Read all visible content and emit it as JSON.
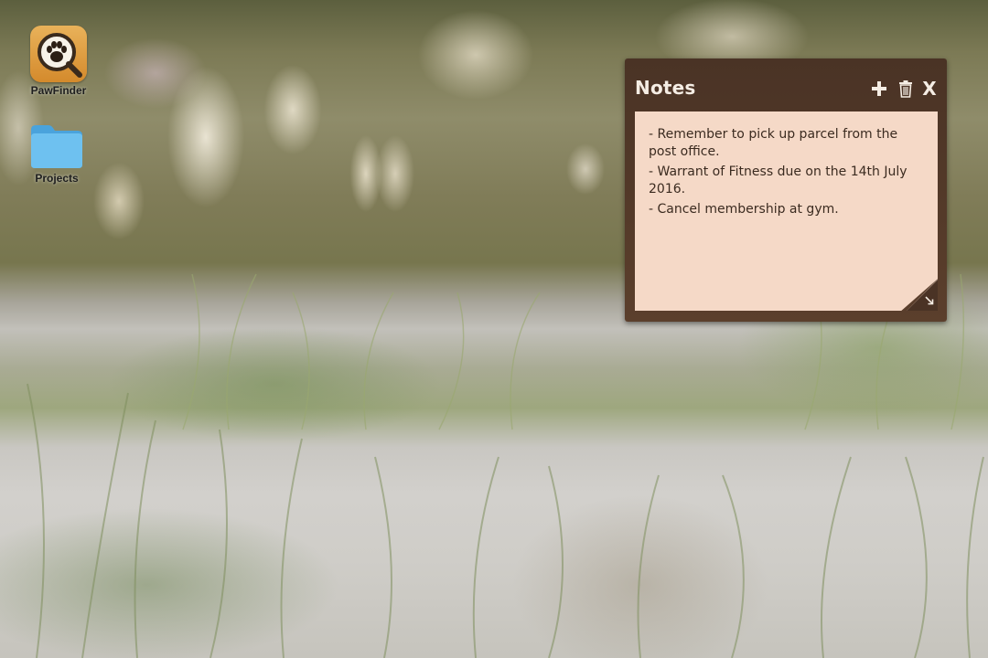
{
  "desktop": {
    "icons": [
      {
        "label": "PawFinder",
        "icon": "paw-magnifier-icon"
      },
      {
        "label": "Projects",
        "icon": "folder-icon"
      }
    ]
  },
  "notes_widget": {
    "title": "Notes",
    "actions": {
      "add_icon": "plus-icon",
      "delete_icon": "trash-icon",
      "close_label": "X",
      "resize_icon": "resize-arrow-icon"
    },
    "lines": [
      "- Remember to pick up parcel from the post office.",
      "- Warrant of Fitness due on the 14th July 2016.",
      "- Cancel membership at gym."
    ],
    "colors": {
      "frame": "#4a3325",
      "paper": "#f5d9c7",
      "title_text": "#f5ede4"
    }
  }
}
